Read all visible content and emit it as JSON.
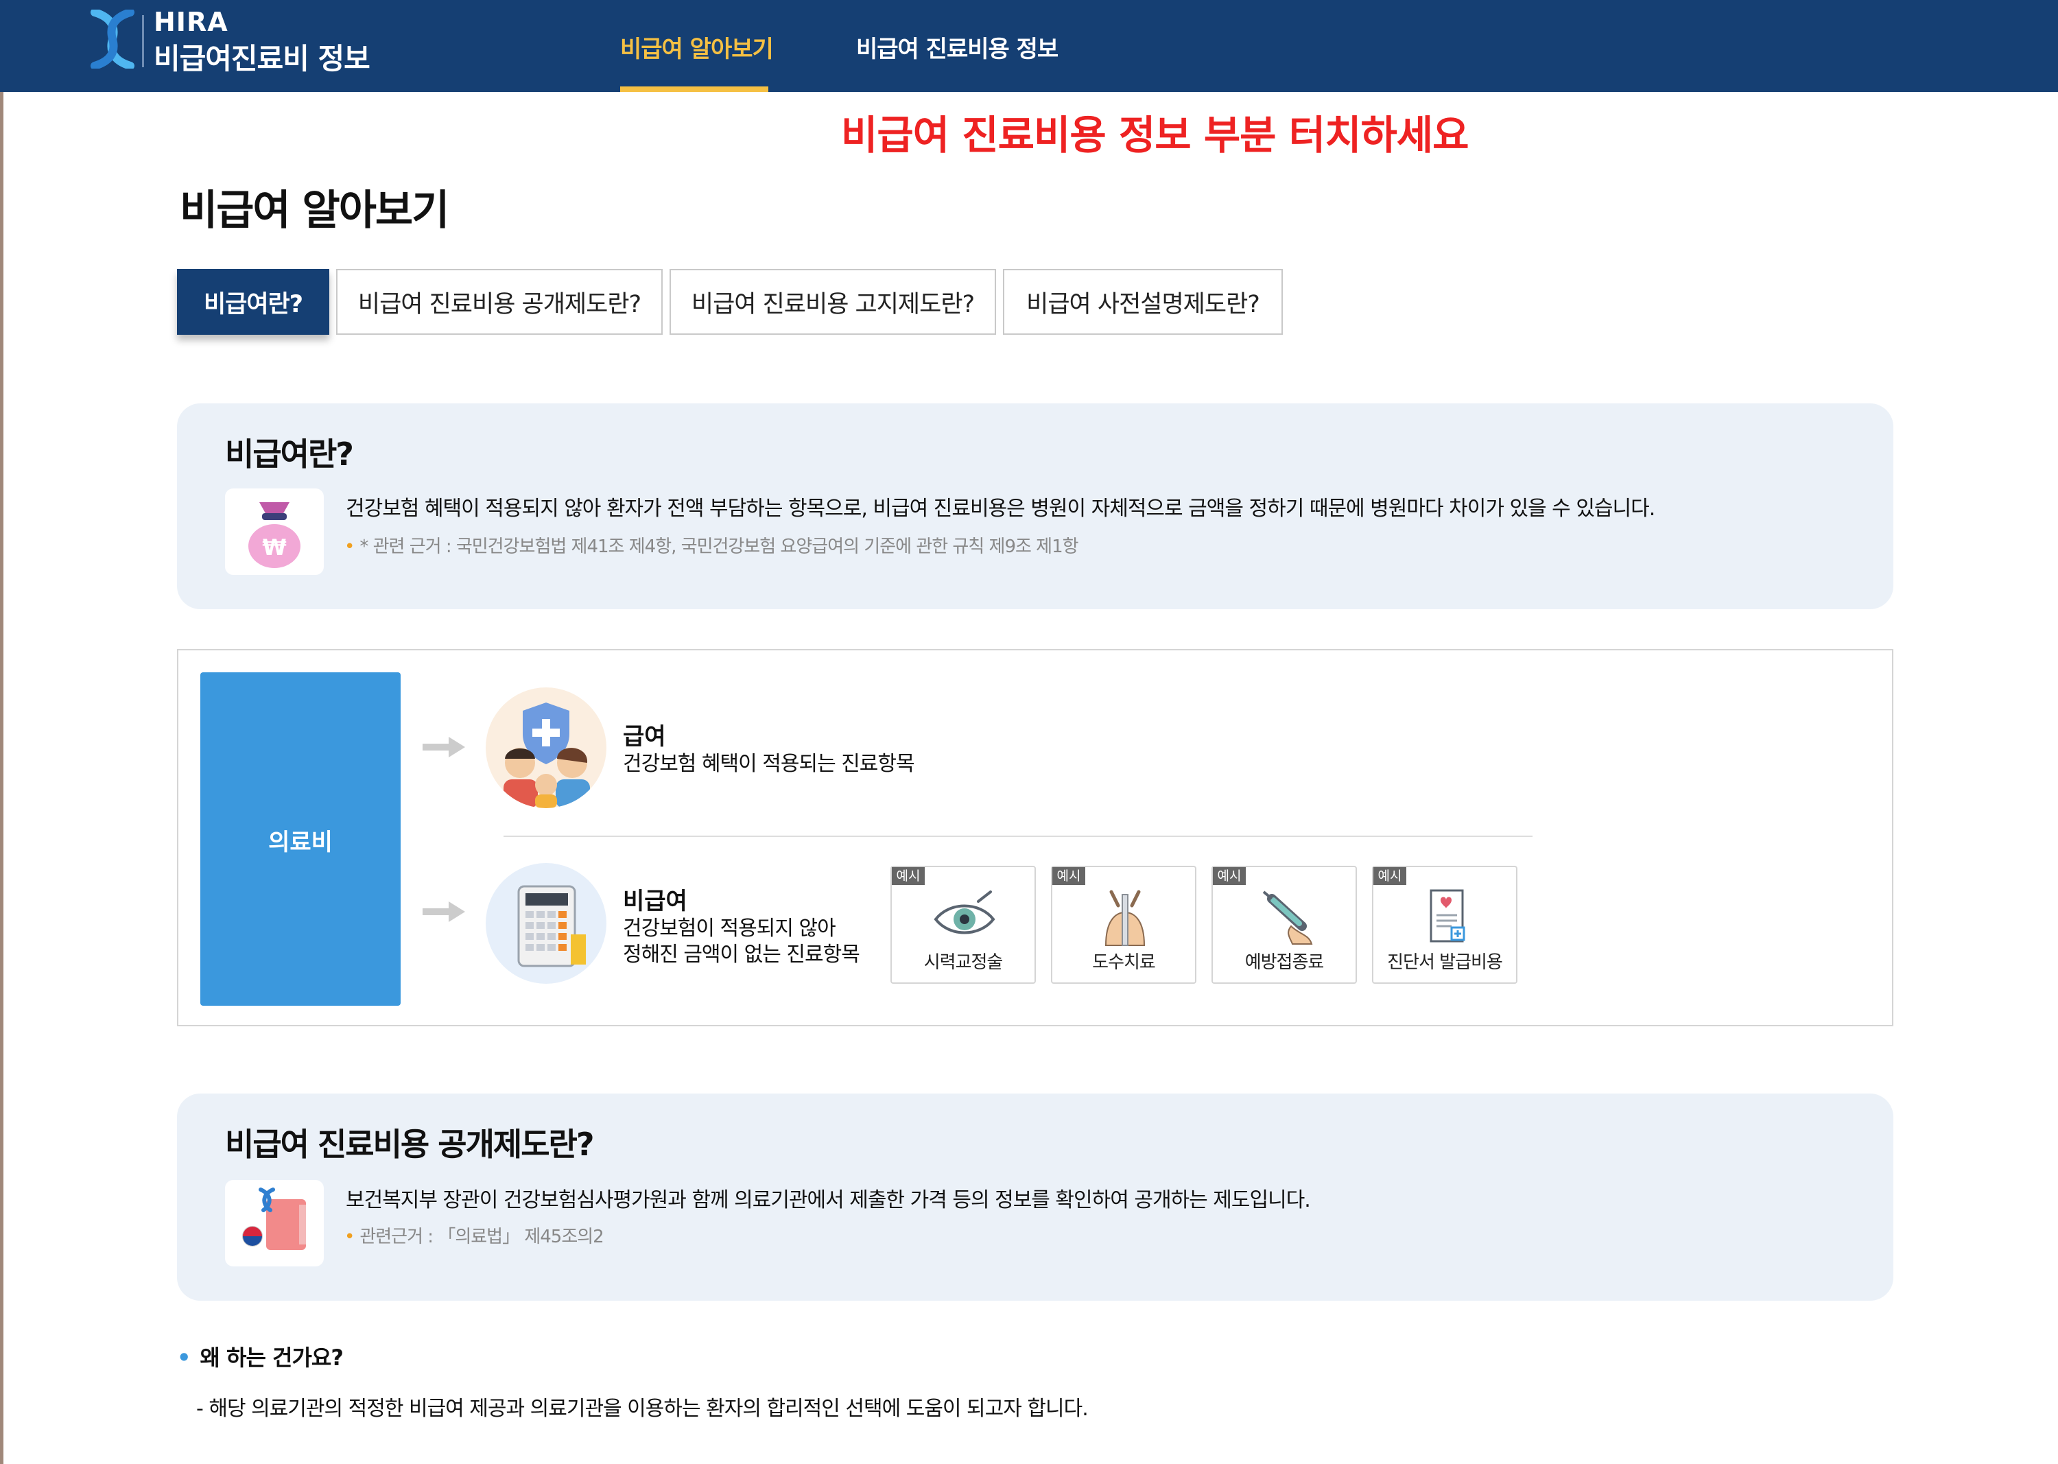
{
  "header": {
    "logo_en": "HIRA",
    "logo_ko": "비급여진료비 정보",
    "nav": [
      {
        "label": "비급여 알아보기",
        "active": true
      },
      {
        "label": "비급여 진료비용 정보",
        "active": false
      }
    ]
  },
  "instruction": "비급여 진료비용 정보 부분 터치하세요",
  "page_title": "비급여 알아보기",
  "tabs": [
    {
      "label": "비급여란?",
      "active": true
    },
    {
      "label": "비급여 진료비용 공개제도란?",
      "active": false
    },
    {
      "label": "비급여 진료비용 고지제도란?",
      "active": false
    },
    {
      "label": "비급여 사전설명제도란?",
      "active": false
    }
  ],
  "section1": {
    "title": "비급여란?",
    "text": "건강보험 혜택이 적용되지 않아 환자가 전액 부담하는 항목으로, 비급여 진료비용은 병원이 자체적으로 금액을 정하기 때문에 병원마다 차이가 있을 수 있습니다.",
    "note": "* 관련 근거 : 국민건강보험법 제41조 제4항, 국민건강보험 요양급여의 기준에 관한 규칙 제9조 제1항"
  },
  "diagram": {
    "box_label": "의료비",
    "covered": {
      "title": "급여",
      "desc": "건강보험 혜택이 적용되는 진료항목"
    },
    "uncovered": {
      "title": "비급여",
      "desc_line1": "건강보험이 적용되지 않아",
      "desc_line2": "정해진 금액이 없는 진료항목"
    },
    "example_badge": "예시",
    "examples": [
      {
        "label": "시력교정술",
        "icon": "eye-icon"
      },
      {
        "label": "도수치료",
        "icon": "manual-therapy-icon"
      },
      {
        "label": "예방접종료",
        "icon": "syringe-icon"
      },
      {
        "label": "진단서 발급비용",
        "icon": "certificate-icon"
      }
    ]
  },
  "section2": {
    "title": "비급여 진료비용 공개제도란?",
    "text": "보건복지부 장관이 건강보험심사평가원과 함께 의료기관에서 제출한 가격 등의 정보를 확인하여 공개하는 제도입니다.",
    "note": "관련근거 : 「의료법」 제45조의2"
  },
  "why": {
    "question": "왜 하는 건가요?",
    "answer": "- 해당 의료기관의 적정한 비급여 제공과 의료기관을 이용하는 환자의 합리적인 선택에 도움이 되고자 합니다."
  },
  "colors": {
    "header_bg": "#153f73",
    "nav_active": "#f5c043",
    "instruction": "#ee2222",
    "card_bg": "#ebf1f8",
    "diagram_box": "#3b98dd"
  }
}
